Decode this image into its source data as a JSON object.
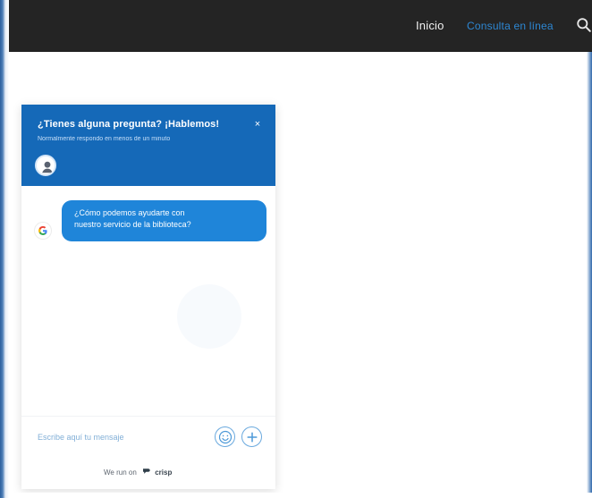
{
  "top_nav": {
    "home_label": "Inicio",
    "online_label": "Consulta en línea",
    "search_icon": "search-icon",
    "background": "#242424",
    "active_color": "#2f99f2"
  },
  "chat": {
    "header_title": "¿Tienes alguna pregunta? ¡Hablemos!",
    "header_subtitle": "Normalmente respondo en menos de un minuto",
    "close_label": "×",
    "avatar_icon": "user-avatar-icon",
    "message_line_1": "¿Cómo podemos ayudarte con",
    "message_line_2": "nuestro servicio de la biblioteca?",
    "message_avatar_icon": "google-g-icon",
    "input_placeholder": "Escribe aquí tu mensaje",
    "emoji_icon": "smile-icon",
    "attach_icon": "plus-icon",
    "brand_prefix": "We run on",
    "brand_name": "crisp",
    "accent": "#1569b8",
    "bubble_color": "#1f85d9"
  }
}
